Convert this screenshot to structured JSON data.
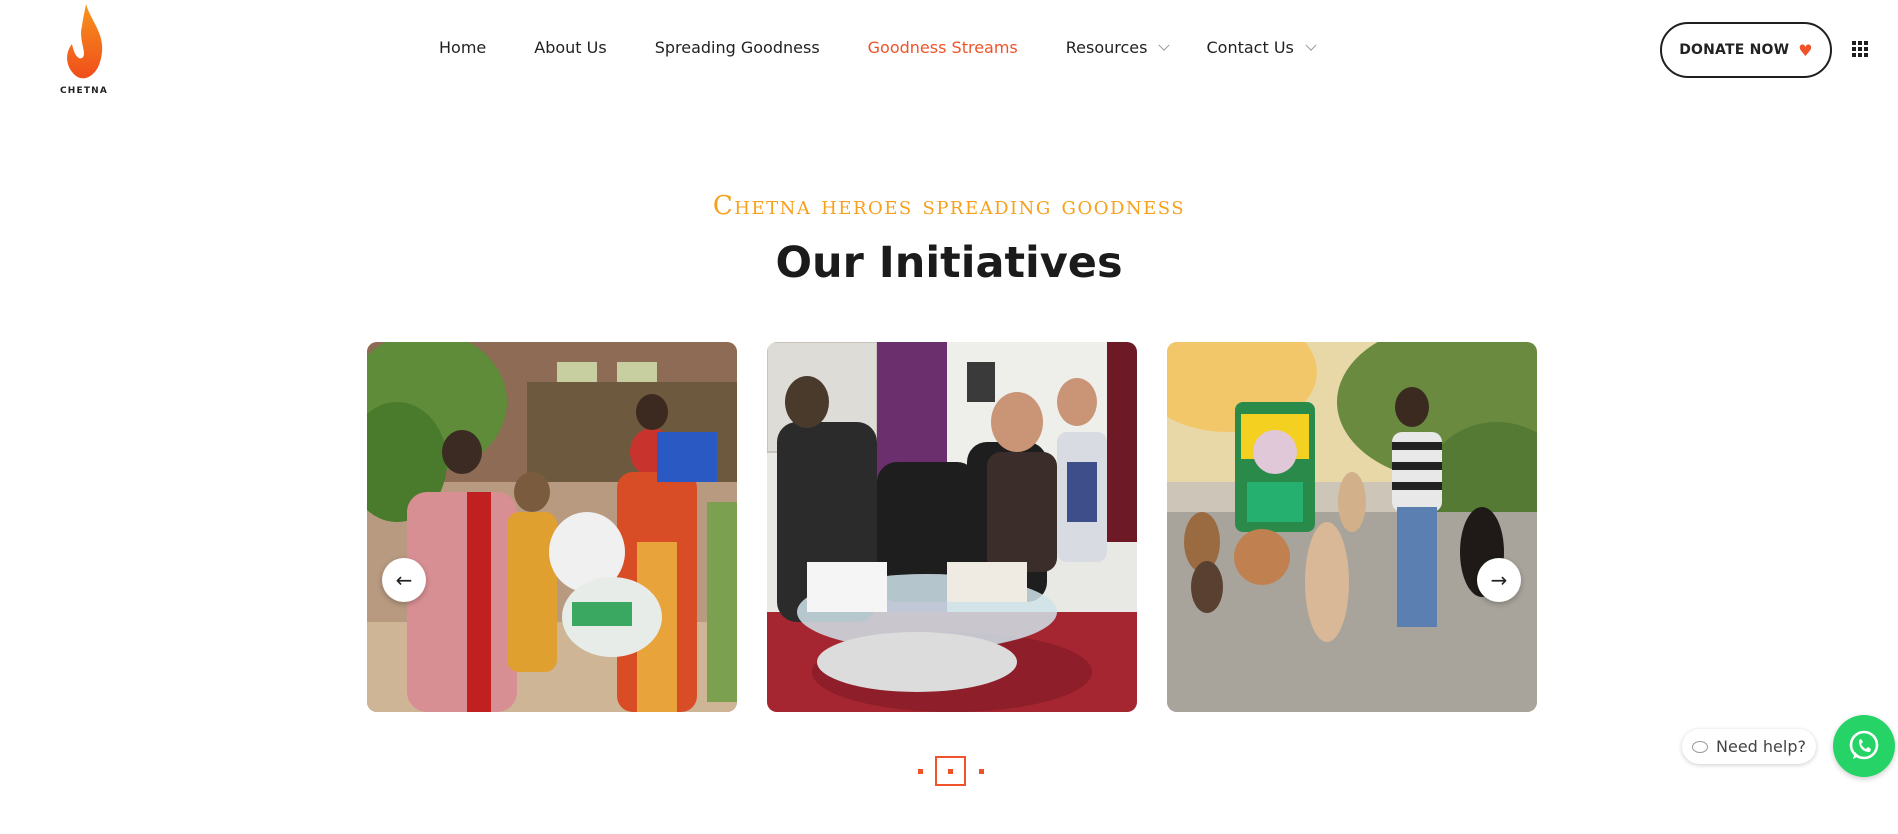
{
  "brand": {
    "name": "CHETNA",
    "accent_color": "#f0532a",
    "kicker_color": "#f7a01c"
  },
  "nav": {
    "items": [
      {
        "label": "Home"
      },
      {
        "label": "About Us"
      },
      {
        "label": "Spreading Goodness"
      },
      {
        "label": "Goodness Streams",
        "active": true
      },
      {
        "label": "Resources",
        "dropdown": true
      },
      {
        "label": "Contact Us",
        "dropdown": true
      }
    ]
  },
  "header": {
    "donate_label": "DONATE NOW",
    "donate_icon": "heart-icon",
    "menu_icon": "grid-menu-icon"
  },
  "section": {
    "kicker": "Chetna heroes spreading goodness",
    "title": "Our Initiatives"
  },
  "carousel": {
    "slides": [
      {
        "image": "food-distribution-photo"
      },
      {
        "image": "family-meeting-photo"
      },
      {
        "image": "feeding-stray-dogs-photo"
      }
    ],
    "prev_icon": "arrow-left-icon",
    "next_icon": "arrow-right-icon",
    "pagination": {
      "count": 3,
      "active_index": 1
    }
  },
  "help_widget": {
    "label": "Need help?",
    "icon": "whatsapp-icon"
  }
}
